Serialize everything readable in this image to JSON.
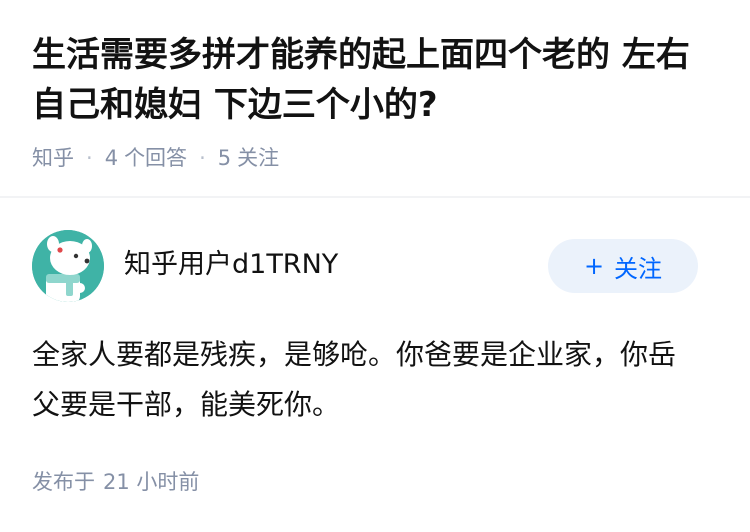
{
  "question": {
    "title": "生活需要多拼才能养的起上面四个老的 左右自己和媳妇 下边三个小的?",
    "source": "知乎",
    "answers_count": "4",
    "answers_label": "个回答",
    "followers_count": "5",
    "followers_label": "关注"
  },
  "answer": {
    "author_name": "知乎用户d1TRNY",
    "follow_button": {
      "icon": "plus-icon",
      "label": "关注"
    },
    "content": "全家人要都是残疾，是够呛。你爸要是企业家，你岳父要是干部，能美死你。",
    "published_label": "发布于",
    "published_time": "21 小时前"
  },
  "colors": {
    "accent": "#0066ff",
    "follow_bg": "#ebf2fb",
    "meta_text": "#8590a6",
    "avatar_bg": "#3fb3a6"
  }
}
